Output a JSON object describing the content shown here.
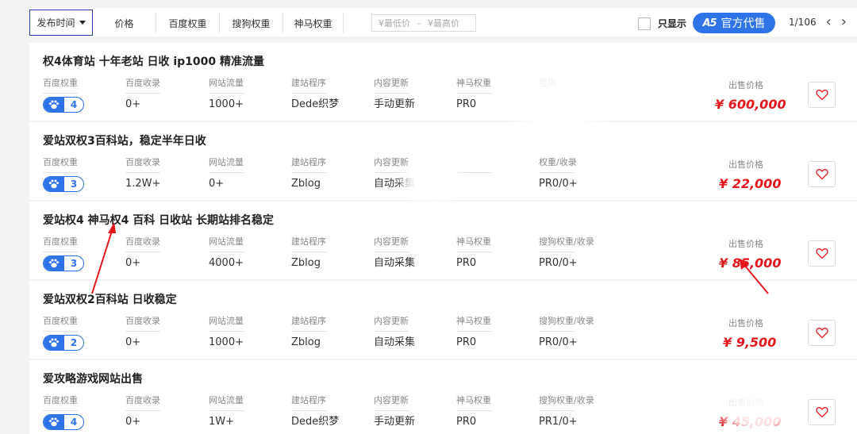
{
  "filter_bar": {
    "sort_label": "发布时间",
    "filters": [
      "价格",
      "百度权重",
      "搜狗权重",
      "神马权重"
    ],
    "price_min_placeholder": "¥最低价",
    "price_separator": "-",
    "price_max_placeholder": "¥最高价",
    "only_show_label": "只显示",
    "official_logo": "A5",
    "official_label": "官方代售",
    "pager_text": "1/106",
    "prev_icon": "‹",
    "next_icon": "›"
  },
  "price_label": "出售价格",
  "listings": [
    {
      "title": "权4体育站 十年老站 日收 ip1000 精准流量",
      "columns": [
        {
          "label": "百度权重",
          "badge": "4"
        },
        {
          "label": "百度收录",
          "value": "0+"
        },
        {
          "label": "网站流量",
          "value": "1000+"
        },
        {
          "label": "建站程序",
          "value": "Dede织梦"
        },
        {
          "label": "内容更新",
          "value": "手动更新"
        },
        {
          "label": "神马权重",
          "value": "PR0"
        },
        {
          "label": "搜狗",
          "value": ""
        }
      ],
      "price": "¥ 600,000"
    },
    {
      "title": "爱站双权3百科站，稳定半年日收",
      "columns": [
        {
          "label": "百度权重",
          "badge": "3"
        },
        {
          "label": "百度收录",
          "value": "1.2W+"
        },
        {
          "label": "网站流量",
          "value": "0+"
        },
        {
          "label": "建站程序",
          "value": "Zblog"
        },
        {
          "label": "内容更新",
          "value": "自动采集"
        },
        {
          "label": "",
          "value": ""
        },
        {
          "label": "权重/收录",
          "value": "PR0/0+"
        }
      ],
      "price": "¥ 22,000"
    },
    {
      "title": "爱站权4 神马权4 百科 日收站 长期站排名稳定",
      "columns": [
        {
          "label": "百度权重",
          "badge": "3"
        },
        {
          "label": "百度收录",
          "value": "0+"
        },
        {
          "label": "网站流量",
          "value": "4000+"
        },
        {
          "label": "建站程序",
          "value": "Zblog"
        },
        {
          "label": "内容更新",
          "value": "自动采集"
        },
        {
          "label": "神马权重",
          "value": "PR0"
        },
        {
          "label": "搜狗权重/收录",
          "value": "PR0/0+"
        }
      ],
      "price": "¥ 85,000"
    },
    {
      "title": "爱站双权2百科站 日收稳定",
      "columns": [
        {
          "label": "百度权重",
          "badge": "2"
        },
        {
          "label": "百度收录",
          "value": "0+"
        },
        {
          "label": "网站流量",
          "value": "1000+"
        },
        {
          "label": "建站程序",
          "value": "Zblog"
        },
        {
          "label": "内容更新",
          "value": "自动采集"
        },
        {
          "label": "神马权重",
          "value": "PR0"
        },
        {
          "label": "搜狗权重/收录",
          "value": "PR0/0+"
        }
      ],
      "price": "¥ 9,500"
    },
    {
      "title": "爱攻略游戏网站出售",
      "columns": [
        {
          "label": "百度权重",
          "badge": "4"
        },
        {
          "label": "百度收录",
          "value": "0+"
        },
        {
          "label": "网站流量",
          "value": "1W+"
        },
        {
          "label": "建站程序",
          "value": "Dede织梦"
        },
        {
          "label": "内容更新",
          "value": "手动更新"
        },
        {
          "label": "神马权重",
          "value": "PR0"
        },
        {
          "label": "搜狗权重/收录",
          "value": "PR1/0+"
        }
      ],
      "price": "¥ 45,000"
    }
  ],
  "colors": {
    "accent": "#2f73e8",
    "price": "#e4161b",
    "annotation": "#e4161b"
  },
  "icons": {
    "badge": "paw-icon",
    "favorite": "heart-icon",
    "sort": "caret-down-icon"
  }
}
